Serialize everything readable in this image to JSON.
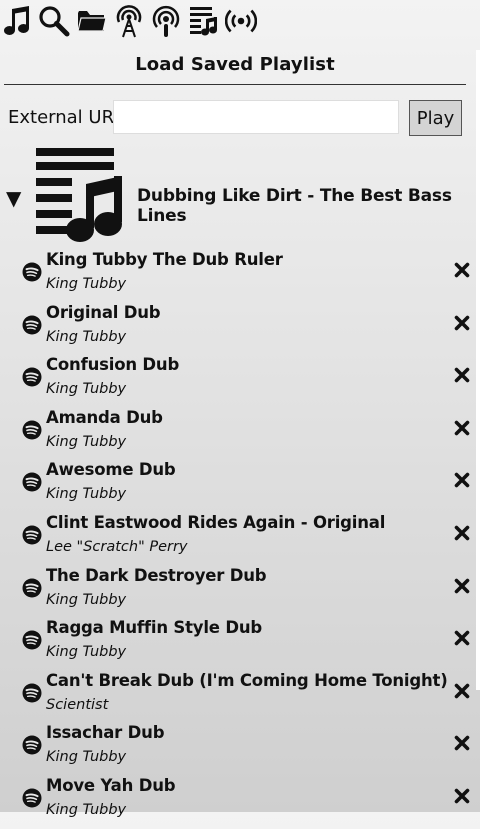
{
  "toolbar": {
    "icons": [
      "music-note-icon",
      "search-icon",
      "folder-icon",
      "radio-tower-icon",
      "podcast-icon",
      "playlist-icon",
      "broadcast-icon"
    ]
  },
  "page_title": "Load Saved Playlist",
  "external_url": {
    "label": "External URL",
    "value": "",
    "placeholder": ""
  },
  "play_button": "Play",
  "playlist": {
    "expanded": true,
    "name": "Dubbing Like Dirt - The Best Bass Lines",
    "tracks": [
      {
        "title": "King Tubby The Dub Ruler",
        "artist": "King Tubby"
      },
      {
        "title": "Original Dub",
        "artist": "King Tubby"
      },
      {
        "title": "Confusion Dub",
        "artist": "King Tubby"
      },
      {
        "title": "Amanda Dub",
        "artist": "King Tubby"
      },
      {
        "title": "Awesome Dub",
        "artist": "King Tubby"
      },
      {
        "title": "Clint Eastwood Rides Again - Original",
        "artist": "Lee \"Scratch\" Perry"
      },
      {
        "title": "The Dark Destroyer Dub",
        "artist": "King Tubby"
      },
      {
        "title": "Ragga Muffin Style Dub",
        "artist": "King Tubby"
      },
      {
        "title": "Can't Break Dub (I'm Coming Home Tonight)",
        "artist": "Scientist"
      },
      {
        "title": "Issachar Dub",
        "artist": "King Tubby"
      },
      {
        "title": "Move Yah Dub",
        "artist": "King Tubby"
      }
    ]
  }
}
